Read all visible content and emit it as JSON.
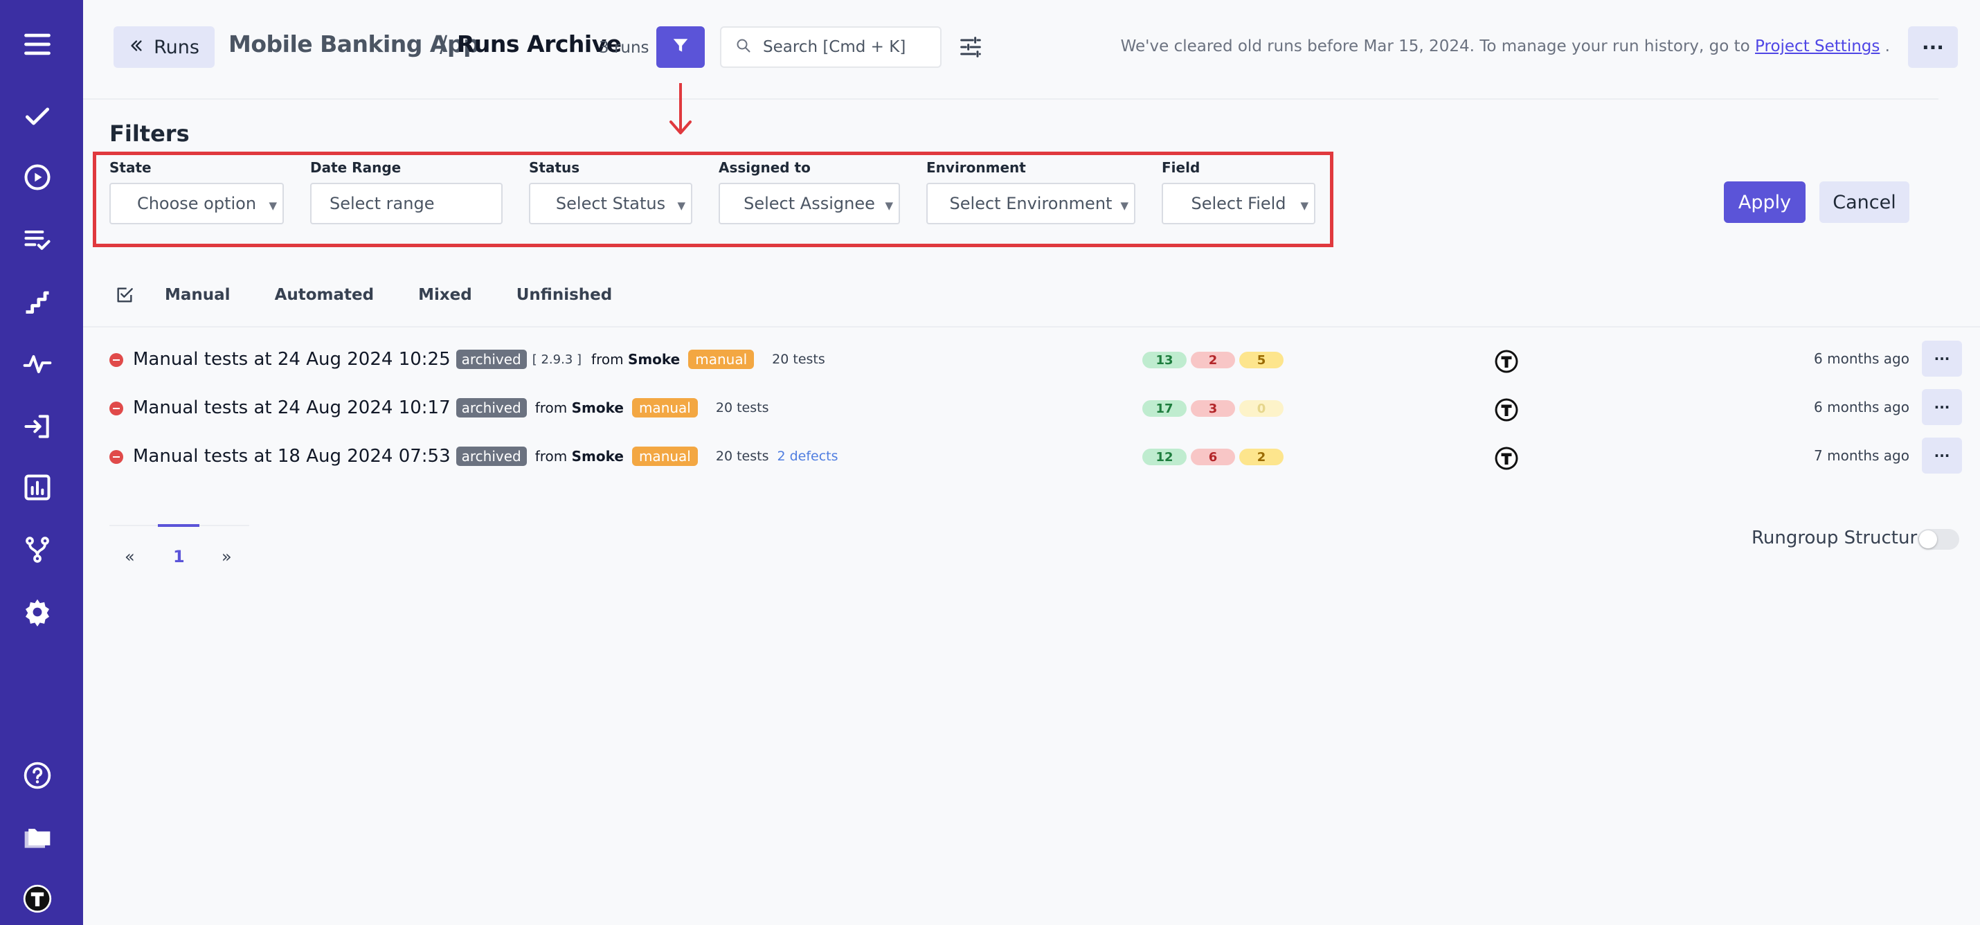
{
  "colors": {
    "sidebar": "#3b2fa3",
    "accent": "#5b54d8",
    "highlight": "#e0393e"
  },
  "sidebar": {
    "items": [
      {
        "icon": "menu-icon"
      },
      {
        "icon": "checkmark-icon"
      },
      {
        "icon": "play-circle-icon"
      },
      {
        "icon": "checklist-icon"
      },
      {
        "icon": "steps-icon"
      },
      {
        "icon": "pulse-icon"
      },
      {
        "icon": "import-icon"
      },
      {
        "icon": "bar-chart-icon"
      },
      {
        "icon": "branch-icon"
      },
      {
        "icon": "gear-icon"
      },
      {
        "icon": "help-icon"
      },
      {
        "icon": "folder-icon"
      },
      {
        "icon": "user-avatar-icon"
      }
    ]
  },
  "header": {
    "back_label": "Runs",
    "project": "Mobile Banking App",
    "separator": "/",
    "page": "Runs Archive",
    "runs_count": "3 runs",
    "search_placeholder": "Search [Cmd + K]",
    "notice_text": "We've cleared old runs before Mar 15, 2024. To manage your run history, go to ",
    "notice_link": "Project Settings",
    "notice_end": " .",
    "more": "···"
  },
  "filters": {
    "title": "Filters",
    "fields": [
      {
        "label": "State",
        "placeholder": "Choose option"
      },
      {
        "label": "Date Range",
        "placeholder": "Select range"
      },
      {
        "label": "Status",
        "placeholder": "Select Status"
      },
      {
        "label": "Assigned to",
        "placeholder": "Select Assignee"
      },
      {
        "label": "Environment",
        "placeholder": "Select Environment"
      },
      {
        "label": "Field",
        "placeholder": "Select Field"
      }
    ],
    "apply_label": "Apply",
    "cancel_label": "Cancel"
  },
  "tabs": [
    "Manual",
    "Automated",
    "Mixed",
    "Unfinished"
  ],
  "runs": [
    {
      "title": "Manual tests at 24 Aug 2024 10:25",
      "archived": "archived",
      "version": "[ 2.9.3 ]",
      "from_label": "from",
      "from": "Smoke",
      "type": "manual",
      "tests": "20 tests",
      "defects": "",
      "passed": "13",
      "failed": "2",
      "skipped": "5",
      "ago": "6 months ago"
    },
    {
      "title": "Manual tests at 24 Aug 2024 10:17",
      "archived": "archived",
      "version": "",
      "from_label": "from",
      "from": "Smoke",
      "type": "manual",
      "tests": "20 tests",
      "defects": "",
      "passed": "17",
      "failed": "3",
      "skipped": "0",
      "ago": "6 months ago"
    },
    {
      "title": "Manual tests at 18 Aug 2024 07:53",
      "archived": "archived",
      "version": "",
      "from_label": "from",
      "from": "Smoke",
      "type": "manual",
      "tests": "20 tests",
      "defects": "2 defects",
      "passed": "12",
      "failed": "6",
      "skipped": "2",
      "ago": "7 months ago"
    }
  ],
  "pagination": {
    "prev": "«",
    "current": "1",
    "next": "»"
  },
  "rungroup": {
    "label": "Rungroup Structure",
    "enabled": false
  }
}
